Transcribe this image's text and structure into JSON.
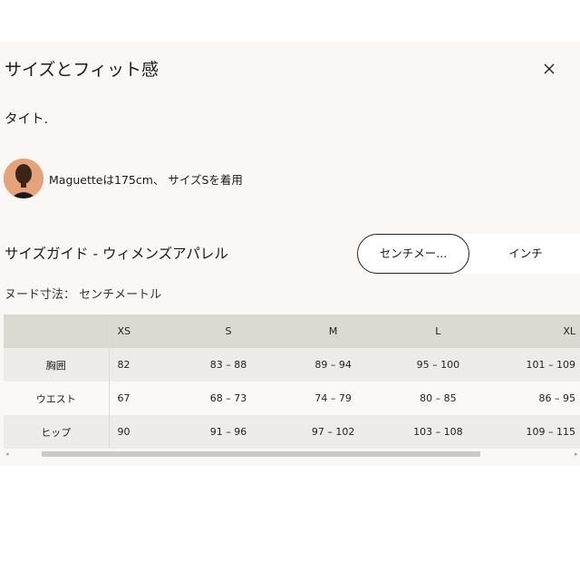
{
  "modal": {
    "title": "サイズとフィット感",
    "fit": "タイト.",
    "model_text": "Maguetteは175cm、 サイズSを着用"
  },
  "guide": {
    "title": "サイズガイド - ウィメンズアパレル",
    "unit_options": [
      "センチメー...",
      "インチ"
    ],
    "selected_unit": "センチメー...",
    "unit_note": "ヌード寸法： センチメートル"
  },
  "size_table": {
    "headers": [
      "",
      "XS",
      "S",
      "M",
      "L",
      "XL"
    ],
    "rows": [
      {
        "label": "胸囲",
        "values": [
          "82",
          "83 – 88",
          "89 – 94",
          "95 – 100",
          "101 – 109"
        ]
      },
      {
        "label": "ウエスト",
        "values": [
          "67",
          "68 – 73",
          "74 – 79",
          "80 – 85",
          "86 – 95"
        ]
      },
      {
        "label": "ヒップ",
        "values": [
          "90",
          "91 – 96",
          "97 – 102",
          "103 – 108",
          "109 – 115"
        ]
      }
    ]
  },
  "colors": {
    "panel_bg": "#fbf7f5",
    "header_bg": "#dcd9d3",
    "row_alt_bg": "#efebe8",
    "avatar_skin": "#e6a37a"
  },
  "icons": {
    "close": "close-icon",
    "scroll_left": "chevron-left-icon",
    "scroll_right": "chevron-right-icon"
  }
}
